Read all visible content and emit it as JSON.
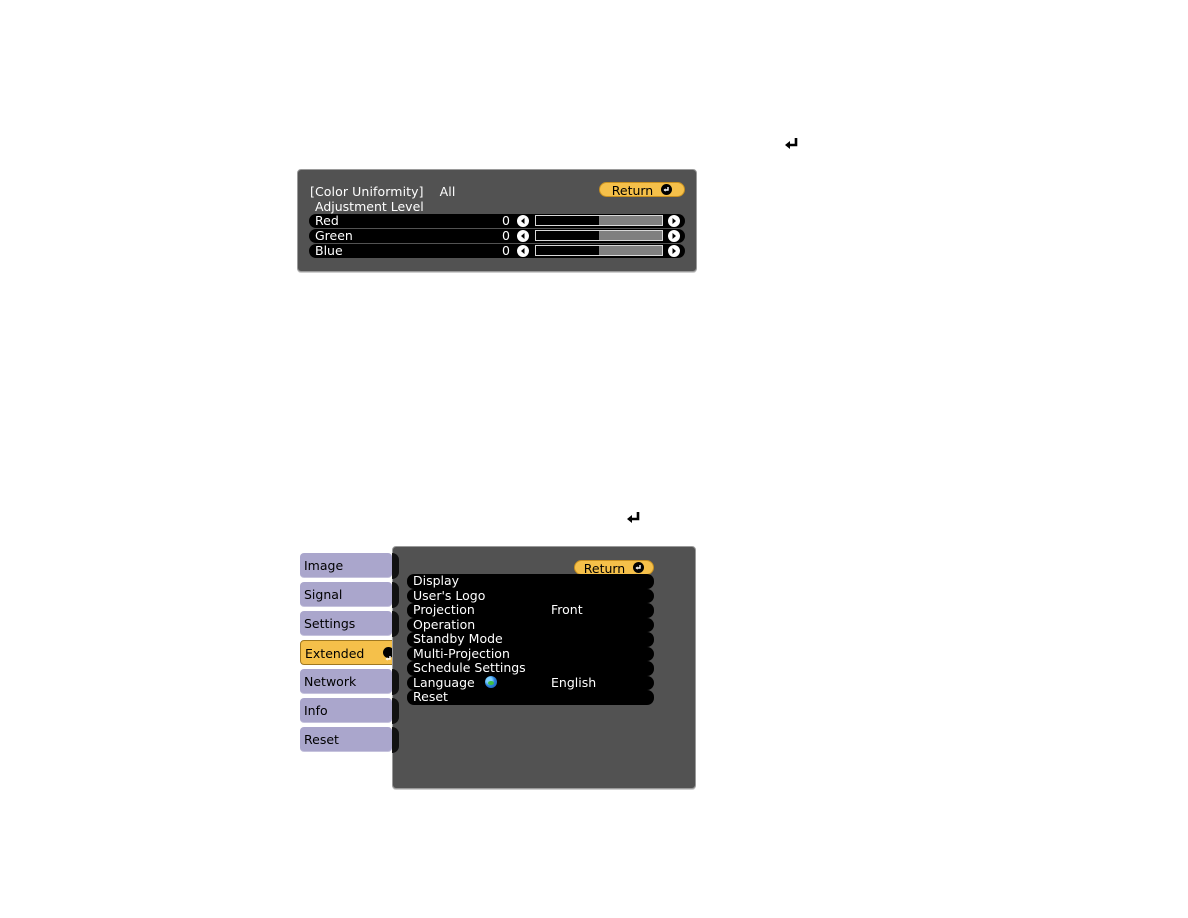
{
  "glyphs": {
    "top_enter_icon": "enter-icon",
    "bottom_enter_icon": "enter-icon"
  },
  "color_uniformity": {
    "title": "[Color Uniformity]",
    "scope": "All",
    "return_label": "Return",
    "subheading": "Adjustment Level",
    "rows": [
      {
        "label": "Red",
        "value": "0",
        "level_fraction": 0.5
      },
      {
        "label": "Green",
        "value": "0",
        "level_fraction": 0.5
      },
      {
        "label": "Blue",
        "value": "0",
        "level_fraction": 0.5
      }
    ]
  },
  "extended_menu": {
    "tabs": [
      {
        "label": "Image",
        "active": false
      },
      {
        "label": "Signal",
        "active": false
      },
      {
        "label": "Settings",
        "active": false
      },
      {
        "label": "Extended",
        "active": true
      },
      {
        "label": "Network",
        "active": false
      },
      {
        "label": "Info",
        "active": false
      },
      {
        "label": "Reset",
        "active": false
      }
    ],
    "return_label": "Return",
    "items": [
      {
        "label": "Display",
        "value": ""
      },
      {
        "label": "User's Logo",
        "value": ""
      },
      {
        "label": "Projection",
        "value": "Front"
      },
      {
        "label": "Operation",
        "value": ""
      },
      {
        "label": "Standby Mode",
        "value": ""
      },
      {
        "label": "Multi-Projection",
        "value": ""
      },
      {
        "label": "Schedule Settings",
        "value": ""
      },
      {
        "label": "Language",
        "value": "English",
        "icon": "globe-icon"
      },
      {
        "label": "Reset",
        "value": ""
      }
    ]
  },
  "colors": {
    "panel_bg": "#525252",
    "accent_yellow": "#f5c04a",
    "tab_lavender": "#aaa6cc",
    "row_black": "#000000"
  }
}
